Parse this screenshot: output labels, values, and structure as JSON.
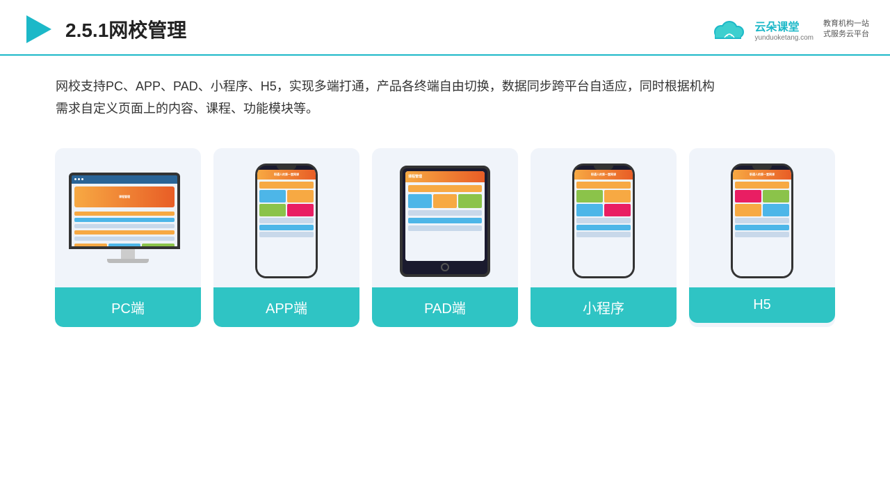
{
  "header": {
    "title": "2.5.1网校管理",
    "logo_name": "云朵课堂",
    "logo_url": "yunduoketang.com",
    "logo_slogan_line1": "教育机构一站",
    "logo_slogan_line2": "式服务云平台"
  },
  "description": {
    "text_line1": "网校支持PC、APP、PAD、小程序、H5，实现多端打通，产品各终端自由切换，数据同步跨平台自适应，同时根据机构",
    "text_line2": "需求自定义页面上的内容、课程、功能模块等。"
  },
  "cards": [
    {
      "label": "PC端",
      "type": "pc"
    },
    {
      "label": "APP端",
      "type": "phone"
    },
    {
      "label": "PAD端",
      "type": "tablet"
    },
    {
      "label": "小程序",
      "type": "phone"
    },
    {
      "label": "H5",
      "type": "phone"
    }
  ],
  "accent_color": "#2fc4c4"
}
